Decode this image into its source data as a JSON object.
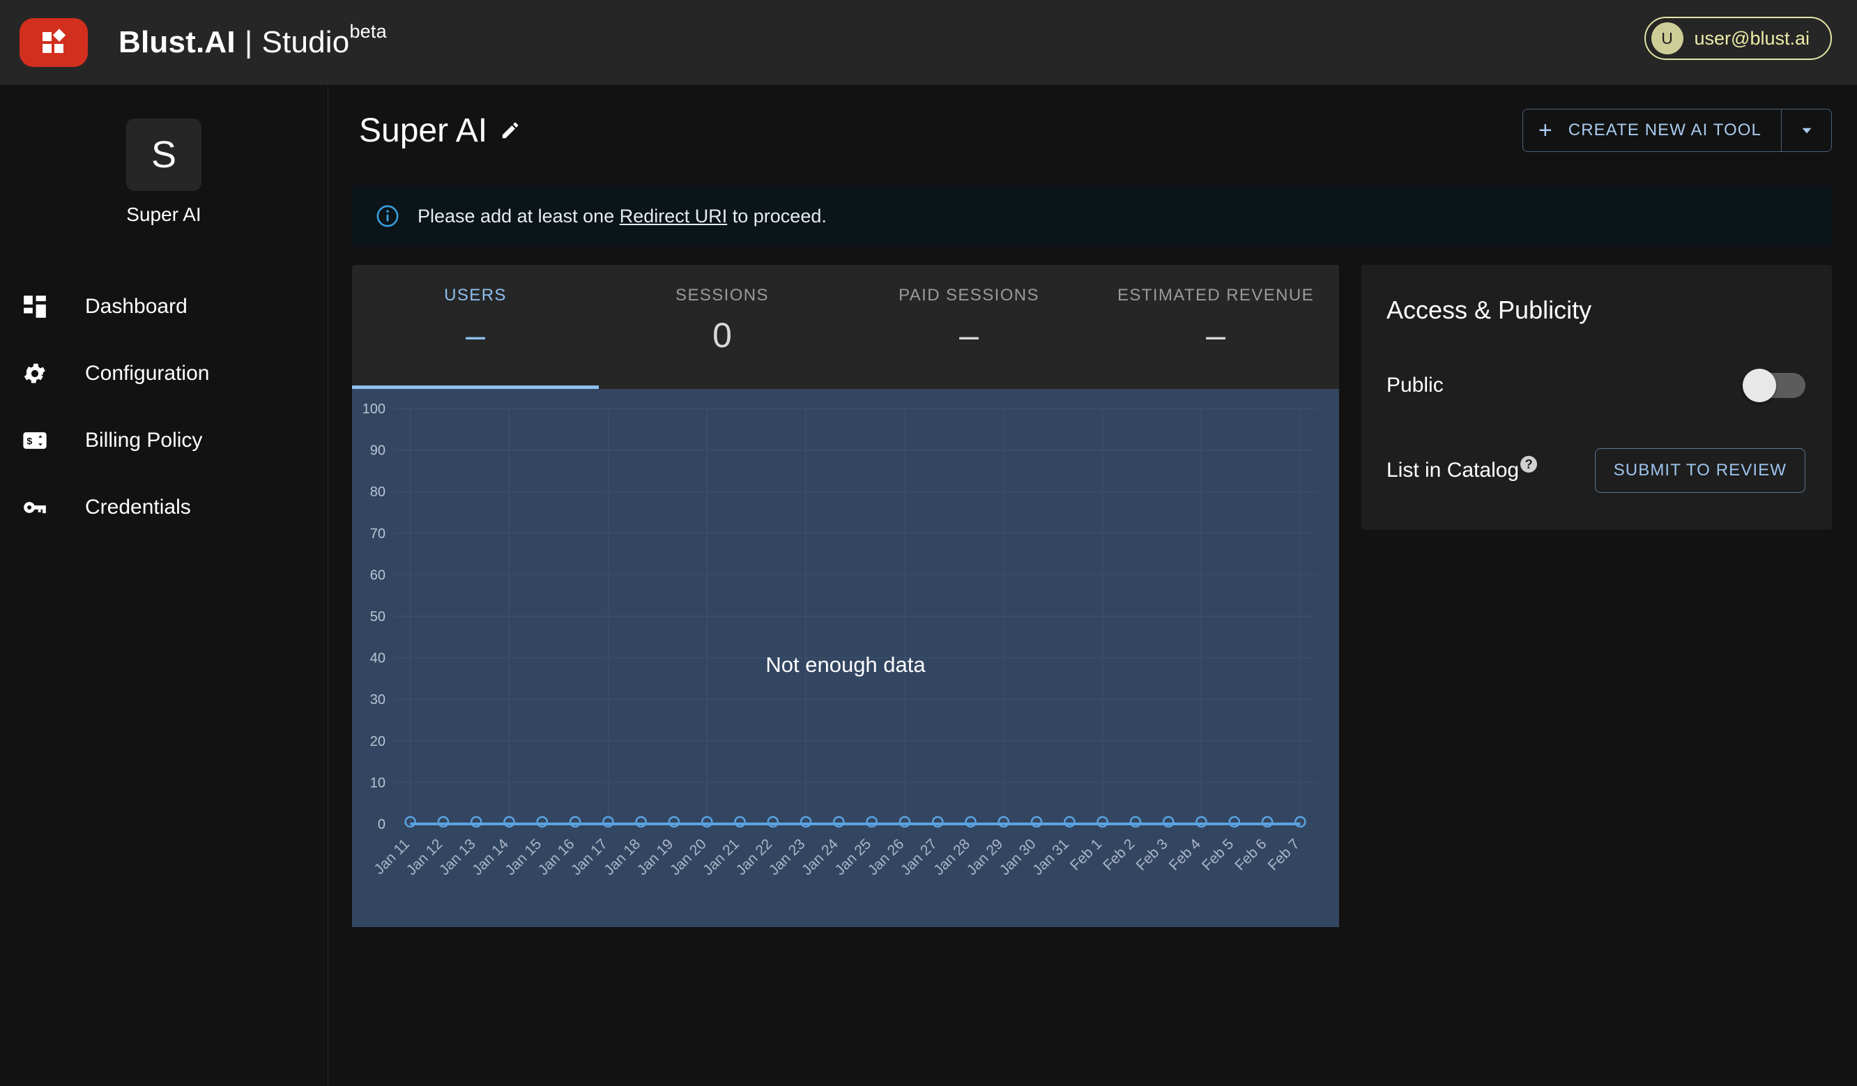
{
  "header": {
    "logo_icon": "blust-logo-icon",
    "brand_strong": "Blust.AI",
    "brand_pipe": "|",
    "brand_light": "Studio",
    "brand_beta": "beta",
    "user": {
      "initial": "U",
      "email": "user@blust.ai"
    }
  },
  "sidebar": {
    "app_initial": "S",
    "app_name": "Super AI",
    "items": [
      {
        "label": "Dashboard",
        "icon": "dashboard-grid-icon"
      },
      {
        "label": "Configuration",
        "icon": "gear-icon"
      },
      {
        "label": "Billing Policy",
        "icon": "billing-card-icon"
      },
      {
        "label": "Credentials",
        "icon": "key-icon"
      }
    ]
  },
  "page": {
    "title": "Super AI",
    "edit_icon": "pencil-icon",
    "create_button": {
      "plus": "+",
      "label": "CREATE NEW AI TOOL",
      "caret_icon": "chevron-down-icon"
    }
  },
  "alert": {
    "icon": "info-circle-icon",
    "text_before": "Please add at least one ",
    "link": "Redirect URI",
    "text_after": " to proceed."
  },
  "stats": {
    "tabs": [
      {
        "label": "USERS",
        "value": "–",
        "active": true
      },
      {
        "label": "SESSIONS",
        "value": "0",
        "active": false
      },
      {
        "label": "PAID SESSIONS",
        "value": "–",
        "active": false
      },
      {
        "label": "ESTIMATED REVENUE",
        "value": "–",
        "active": false
      }
    ],
    "active_index": 0
  },
  "chart_empty_message": "Not enough data",
  "access_panel": {
    "title": "Access & Publicity",
    "public_label": "Public",
    "public_enabled": false,
    "catalog_label": "List in Catalog",
    "catalog_help_icon": "help-circle-icon",
    "submit_label": "SUBMIT TO REVIEW"
  },
  "colors": {
    "brand_red": "#d32f1f",
    "accent_blue": "#8fc0ef",
    "chart_bg": "#334661",
    "chart_line": "#5ba3e0",
    "user_chip": "#e4e4a7",
    "topbar_bg": "#262626",
    "body_bg": "#121212",
    "alert_bg": "#0b1419"
  },
  "chart_data": {
    "type": "line",
    "title": "",
    "xlabel": "",
    "ylabel": "",
    "series": [
      {
        "name": "Users",
        "values": [
          0,
          0,
          0,
          0,
          0,
          0,
          0,
          0,
          0,
          0,
          0,
          0,
          0,
          0,
          0,
          0,
          0,
          0,
          0,
          0,
          0,
          0,
          0,
          0,
          0,
          0,
          0,
          0
        ]
      }
    ],
    "categories": [
      "Jan 11",
      "Jan 12",
      "Jan 13",
      "Jan 14",
      "Jan 15",
      "Jan 16",
      "Jan 17",
      "Jan 18",
      "Jan 19",
      "Jan 20",
      "Jan 21",
      "Jan 22",
      "Jan 23",
      "Jan 24",
      "Jan 25",
      "Jan 26",
      "Jan 27",
      "Jan 28",
      "Jan 29",
      "Jan 30",
      "Jan 31",
      "Feb 1",
      "Feb 2",
      "Feb 3",
      "Feb 4",
      "Feb 5",
      "Feb 6",
      "Feb 7"
    ],
    "yticks": [
      0,
      10,
      20,
      30,
      40,
      50,
      60,
      70,
      80,
      90,
      100
    ],
    "ylim": [
      0,
      100
    ],
    "grid": true,
    "legend": "none",
    "annotation": "Not enough data",
    "marker": "circle-open",
    "xtick_rotation": -45
  }
}
